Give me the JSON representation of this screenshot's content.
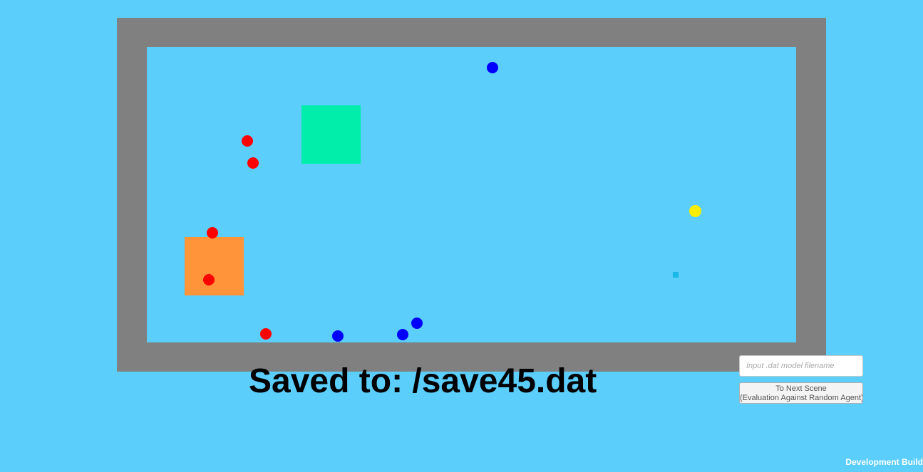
{
  "status": {
    "saved_text": "Saved to: /save45.dat"
  },
  "model_input": {
    "placeholder": "Input .dat model filename",
    "value": ""
  },
  "next_scene_button": {
    "line1": "To Next Scene",
    "line2": "(Evaluation Against Random Agent)"
  },
  "footer": {
    "build_label": "Development Build"
  },
  "colors": {
    "background": "#5bcefc",
    "wall": "#808080",
    "green_zone": "#00eeaa",
    "orange_zone": "#ff943a",
    "red_team": "#ff0000",
    "blue_team": "#0000ff",
    "ball": "#ffee00",
    "pickup": "#19b8e6"
  },
  "entities": {
    "red_agents": 5,
    "blue_agents": 4,
    "balls": 1,
    "pickups": 1
  }
}
